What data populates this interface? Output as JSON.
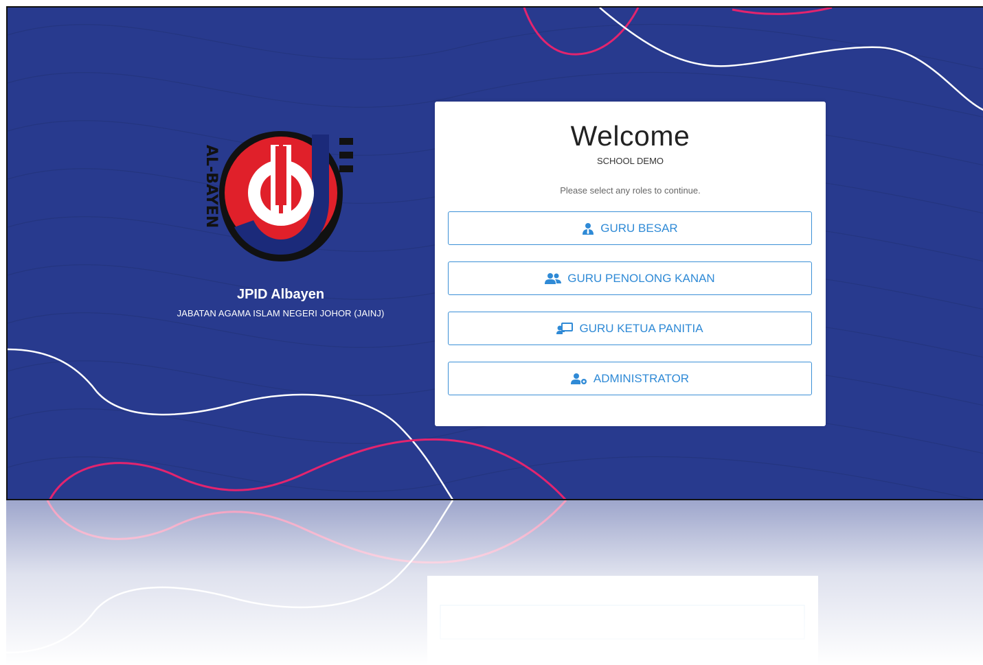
{
  "brand": {
    "name": "JPID Albayen",
    "subtitle": "JABATAN AGAMA ISLAM NEGERI JOHOR (JAINJ)",
    "logo_text": "AL-BAYEN"
  },
  "card": {
    "title": "Welcome",
    "school": "SCHOOL DEMO",
    "hint": "Please select any roles to continue."
  },
  "roles": [
    {
      "label": "GURU BESAR",
      "icon": "user-tie-icon"
    },
    {
      "label": "GURU PENOLONG KANAN",
      "icon": "users-icon"
    },
    {
      "label": "GURU KETUA PANITIA",
      "icon": "chalkboard-teacher-icon"
    },
    {
      "label": "ADMINISTRATOR",
      "icon": "user-cog-icon"
    }
  ],
  "colors": {
    "background": "#283a8e",
    "accent": "#2f8ad6",
    "wave_pink": "#e3246e",
    "wave_white": "#ffffff",
    "logo_red": "#e0202a",
    "logo_navy": "#1b2a7a"
  }
}
